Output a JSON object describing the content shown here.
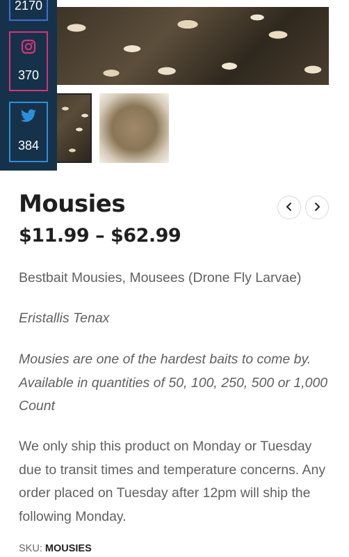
{
  "social": {
    "facebook": {
      "count": "2170",
      "icon": "facebook-icon",
      "color": "#3f6fd6"
    },
    "instagram": {
      "count": "370",
      "icon": "instagram-icon",
      "color": "#d6337a"
    },
    "twitter": {
      "count": "384",
      "icon": "twitter-icon",
      "color": "#2e8fd9"
    }
  },
  "product": {
    "title": "Mousies",
    "price": "$11.99 – $62.99",
    "description": [
      "Bestbait Mousies,  Mousees (Drone Fly Larvae)",
      "Eristallis Tenax",
      "Mousies are one of the hardest baits to come by. Available in quantities of 50, 100, 250, 500 or 1,000 Count",
      "We only ship this product on Monday or Tuesday due to transit times and temperature concerns. Any order placed on Tuesday after 12pm will ship the following Monday."
    ],
    "sku_label": "SKU:",
    "sku_value": "MOUSIES"
  },
  "nav": {
    "prev_icon": "chevron-left-icon",
    "next_icon": "chevron-right-icon"
  }
}
